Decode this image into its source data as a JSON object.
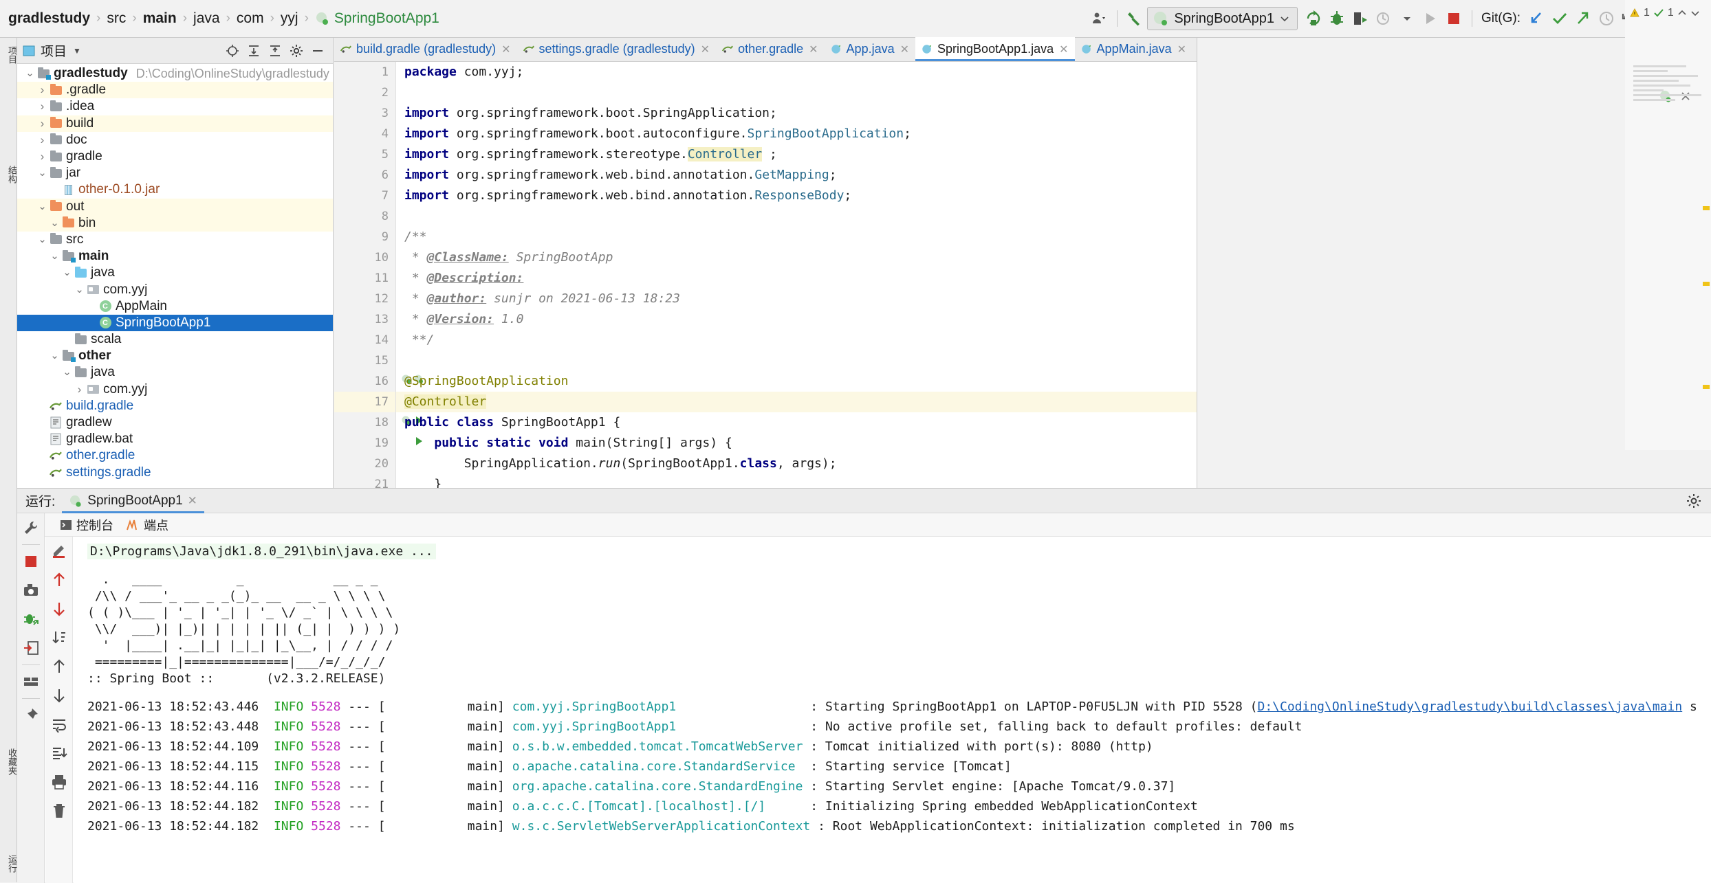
{
  "breadcrumb": {
    "items": [
      {
        "label": "gradlestudy",
        "bold": true
      },
      {
        "label": "src",
        "bold": false
      },
      {
        "label": "main",
        "bold": true
      },
      {
        "label": "java",
        "bold": false
      },
      {
        "label": "com",
        "bold": false
      },
      {
        "label": "yyj",
        "bold": false
      },
      {
        "label": "SpringBootApp1",
        "bold": false
      }
    ]
  },
  "toolbar": {
    "run_config_label": "SpringBootApp1",
    "git_label": "Git(G):",
    "icons": [
      "profile-icon",
      "build-hammer-icon",
      "rerun-icon",
      "debug-icon",
      "run-with-coverage-icon",
      "profile-run-icon",
      "run-icon",
      "stop-icon",
      "git-update-icon",
      "git-commit-icon",
      "git-push-icon",
      "git-history-icon",
      "git-rollback-icon",
      "translate-icon",
      "search-everywhere-icon"
    ]
  },
  "left_strip": {
    "project_tab": "项目",
    "structure_tab": "结构",
    "favorites_tab": "收藏夹",
    "run_tab": "运行"
  },
  "project_panel": {
    "title": "项目",
    "header_icons": [
      "locate-icon",
      "expand-all-icon",
      "collapse-all-icon",
      "settings-gear-icon",
      "hide-icon"
    ],
    "tree": [
      {
        "depth": 0,
        "arrow": "down",
        "icon": "module-folder",
        "label": "gradlestudy",
        "bold": true,
        "path": "D:\\Coding\\OnlineStudy\\gradlestudy",
        "hl": false,
        "sel": false
      },
      {
        "depth": 1,
        "arrow": "right",
        "icon": "folder-orange",
        "label": ".gradle",
        "bold": false,
        "path": "",
        "hl": true,
        "sel": false
      },
      {
        "depth": 1,
        "arrow": "right",
        "icon": "folder-grey",
        "label": ".idea",
        "bold": false,
        "path": "",
        "hl": false,
        "sel": false
      },
      {
        "depth": 1,
        "arrow": "right",
        "icon": "folder-orange",
        "label": "build",
        "bold": false,
        "path": "",
        "hl": true,
        "sel": false
      },
      {
        "depth": 1,
        "arrow": "right",
        "icon": "folder-grey",
        "label": "doc",
        "bold": false,
        "path": "",
        "hl": false,
        "sel": false
      },
      {
        "depth": 1,
        "arrow": "right",
        "icon": "folder-grey",
        "label": "gradle",
        "bold": false,
        "path": "",
        "hl": false,
        "sel": false
      },
      {
        "depth": 1,
        "arrow": "down",
        "icon": "folder-grey",
        "label": "jar",
        "bold": false,
        "path": "",
        "hl": false,
        "sel": false
      },
      {
        "depth": 2,
        "arrow": "none",
        "icon": "jar-file",
        "label": "other-0.1.0.jar",
        "bold": false,
        "path": "",
        "hl": false,
        "sel": false,
        "color": "#9c4a22"
      },
      {
        "depth": 1,
        "arrow": "down",
        "icon": "folder-orange",
        "label": "out",
        "bold": false,
        "path": "",
        "hl": true,
        "sel": false
      },
      {
        "depth": 2,
        "arrow": "down",
        "icon": "folder-orange",
        "label": "bin",
        "bold": false,
        "path": "",
        "hl": true,
        "sel": false
      },
      {
        "depth": 1,
        "arrow": "down",
        "icon": "folder-grey",
        "label": "src",
        "bold": false,
        "path": "",
        "hl": false,
        "sel": false
      },
      {
        "depth": 2,
        "arrow": "down",
        "icon": "module-folder",
        "label": "main",
        "bold": true,
        "path": "",
        "hl": false,
        "sel": false
      },
      {
        "depth": 3,
        "arrow": "down",
        "icon": "folder-blue",
        "label": "java",
        "bold": false,
        "path": "",
        "hl": false,
        "sel": false
      },
      {
        "depth": 4,
        "arrow": "down",
        "icon": "package",
        "label": "com.yyj",
        "bold": false,
        "path": "",
        "hl": false,
        "sel": false
      },
      {
        "depth": 5,
        "arrow": "none",
        "icon": "java-class",
        "label": "AppMain",
        "bold": false,
        "path": "",
        "hl": false,
        "sel": false
      },
      {
        "depth": 5,
        "arrow": "none",
        "icon": "java-class",
        "label": "SpringBootApp1",
        "bold": false,
        "path": "",
        "hl": false,
        "sel": true
      },
      {
        "depth": 3,
        "arrow": "none",
        "icon": "folder-grey",
        "label": "scala",
        "bold": false,
        "path": "",
        "hl": false,
        "sel": false
      },
      {
        "depth": 2,
        "arrow": "down",
        "icon": "module-folder",
        "label": "other",
        "bold": true,
        "path": "",
        "hl": false,
        "sel": false
      },
      {
        "depth": 3,
        "arrow": "down",
        "icon": "folder-grey",
        "label": "java",
        "bold": false,
        "path": "",
        "hl": false,
        "sel": false
      },
      {
        "depth": 4,
        "arrow": "right",
        "icon": "package",
        "label": "com.yyj",
        "bold": false,
        "path": "",
        "hl": false,
        "sel": false
      },
      {
        "depth": 1,
        "arrow": "none",
        "icon": "gradle-file",
        "label": "build.gradle",
        "bold": false,
        "path": "",
        "hl": false,
        "sel": false,
        "color": "#1a5fb4"
      },
      {
        "depth": 1,
        "arrow": "none",
        "icon": "script-file",
        "label": "gradlew",
        "bold": false,
        "path": "",
        "hl": false,
        "sel": false
      },
      {
        "depth": 1,
        "arrow": "none",
        "icon": "script-file",
        "label": "gradlew.bat",
        "bold": false,
        "path": "",
        "hl": false,
        "sel": false
      },
      {
        "depth": 1,
        "arrow": "none",
        "icon": "gradle-file",
        "label": "other.gradle",
        "bold": false,
        "path": "",
        "hl": false,
        "sel": false,
        "color": "#1a5fb4"
      },
      {
        "depth": 1,
        "arrow": "none",
        "icon": "gradle-file",
        "label": "settings.gradle",
        "bold": false,
        "path": "",
        "hl": false,
        "sel": false,
        "color": "#1a5fb4"
      }
    ]
  },
  "editor": {
    "tabs": [
      {
        "label": "build.gradle (gradlestudy)",
        "icon": "gradle-icon",
        "active": false
      },
      {
        "label": "settings.gradle (gradlestudy)",
        "icon": "gradle-icon",
        "active": false
      },
      {
        "label": "other.gradle",
        "icon": "gradle-icon",
        "active": false
      },
      {
        "label": "App.java",
        "icon": "java-icon",
        "active": false
      },
      {
        "label": "SpringBootApp1.java",
        "icon": "java-icon",
        "active": true
      },
      {
        "label": "AppMain.java",
        "icon": "java-icon",
        "active": false
      }
    ],
    "inspection": {
      "warnings": "1",
      "checks": "1"
    },
    "gutter_numbers": [
      "1",
      "2",
      "3",
      "4",
      "5",
      "6",
      "7",
      "8",
      "9",
      "10",
      "11",
      "12",
      "13",
      "14",
      "15",
      "16",
      "17",
      "18",
      "19",
      "20",
      "21"
    ],
    "current_line": 17,
    "code": [
      {
        "n": 1,
        "html": "<span class=\"kw\">package</span> com.yyj;"
      },
      {
        "n": 2,
        "html": ""
      },
      {
        "n": 3,
        "html": "<span class=\"kw\">import</span> org.springframework.boot.SpringApplication;"
      },
      {
        "n": 4,
        "html": "<span class=\"kw\">import</span> org.springframework.boot.autoconfigure.<span class=\"cls\">SpringBootApplication</span>;"
      },
      {
        "n": 5,
        "html": "<span class=\"kw\">import</span> org.springframework.stereotype.<span class=\"hiwarn cls\">Controller</span> ;"
      },
      {
        "n": 6,
        "html": "<span class=\"kw\">import</span> org.springframework.web.bind.annotation.<span class=\"cls\">GetMapping</span>;"
      },
      {
        "n": 7,
        "html": "<span class=\"kw\">import</span> org.springframework.web.bind.annotation.<span class=\"cls\">ResponseBody</span>;"
      },
      {
        "n": 8,
        "html": ""
      },
      {
        "n": 9,
        "html": "<span class=\"cmt\">/**</span>"
      },
      {
        "n": 10,
        "html": "<span class=\"cmt\"> * </span><span class=\"cmt-b\">@ClassName:</span><span class=\"cmt\"> SpringBootApp</span>"
      },
      {
        "n": 11,
        "html": "<span class=\"cmt\"> * </span><span class=\"cmt-b\">@Description:</span>"
      },
      {
        "n": 12,
        "html": "<span class=\"cmt\"> * </span><span class=\"cmt-b\">@author:</span><span class=\"cmt\"> sunjr on 2021-06-13 18:23</span>"
      },
      {
        "n": 13,
        "html": "<span class=\"cmt\"> * </span><span class=\"cmt-b\">@Version:</span><span class=\"cmt\"> 1.0</span>"
      },
      {
        "n": 14,
        "html": "<span class=\"cmt\"> **/</span>"
      },
      {
        "n": 15,
        "html": ""
      },
      {
        "n": 16,
        "html": "<span class=\"ann\">@SpringBootApplication</span>"
      },
      {
        "n": 17,
        "html": "<span class=\"ann hiwarn\">@Controller</span>"
      },
      {
        "n": 18,
        "html": "<span class=\"kw\">public class</span> SpringBootApp1 {"
      },
      {
        "n": 19,
        "html": "    <span class=\"kw\">public static void</span> main(String[] args) {"
      },
      {
        "n": 20,
        "html": "        SpringApplication.<span style=\"font-style:italic\">run</span>(SpringBootApp1.<span class=\"kw\">class</span>, args);"
      },
      {
        "n": 21,
        "html": "    }"
      }
    ]
  },
  "run_panel": {
    "title": "运行:",
    "tab_label": "SpringBootApp1",
    "subtabs": [
      {
        "label": "控制台",
        "icon": "console-icon"
      },
      {
        "label": "端点",
        "icon": "endpoints-icon"
      }
    ],
    "left_icons_1": [
      "wrench-icon",
      "stop-icon",
      "camera-icon",
      "debug-attach-icon",
      "export-icon",
      "layout-icon",
      "pin-icon"
    ],
    "left_icons_2": [
      "highlight-icon",
      "up-red-icon",
      "down-red-icon",
      "sort-down-icon",
      "up-icon",
      "down-icon",
      "soft-wrap-icon",
      "scroll-to-end-icon",
      "print-icon",
      "trash-icon"
    ],
    "command": "D:\\Programs\\Java\\jdk1.8.0_291\\bin\\java.exe ...",
    "banner": [
      "  .   ____          _            __ _ _",
      " /\\\\ / ___'_ __ _ _(_)_ __  __ _ \\ \\ \\ \\",
      "( ( )\\___ | '_ | '_| | '_ \\/ _` | \\ \\ \\ \\",
      " \\\\/  ___)| |_)| | | | | || (_| |  ) ) ) )",
      "  '  |____| .__|_| |_|_| |_\\__, | / / / /",
      " =========|_|==============|___/=/_/_/_/"
    ],
    "banner_version_label": ":: Spring Boot ::",
    "banner_version": "(v2.3.2.RELEASE)",
    "logs": [
      {
        "ts": "2021-06-13 18:52:43.446",
        "level": "INFO",
        "pid": "5528",
        "sep": "--- [",
        "thread": "           main]",
        "logger": "com.yyj.SpringBootApp1",
        "msg": ": Starting SpringBootApp1 on LAPTOP-P0FU5LJN with PID 5528 (",
        "link": "D:\\Coding\\OnlineStudy\\gradlestudy\\build\\classes\\java\\main",
        "tail": " s"
      },
      {
        "ts": "2021-06-13 18:52:43.448",
        "level": "INFO",
        "pid": "5528",
        "sep": "--- [",
        "thread": "           main]",
        "logger": "com.yyj.SpringBootApp1",
        "msg": ": No active profile set, falling back to default profiles: default",
        "link": "",
        "tail": ""
      },
      {
        "ts": "2021-06-13 18:52:44.109",
        "level": "INFO",
        "pid": "5528",
        "sep": "--- [",
        "thread": "           main]",
        "logger": "o.s.b.w.embedded.tomcat.TomcatWebServer",
        "msg": ": Tomcat initialized with port(s): 8080 (http)",
        "link": "",
        "tail": ""
      },
      {
        "ts": "2021-06-13 18:52:44.115",
        "level": "INFO",
        "pid": "5528",
        "sep": "--- [",
        "thread": "           main]",
        "logger": "o.apache.catalina.core.StandardService",
        "msg": ": Starting service [Tomcat]",
        "link": "",
        "tail": ""
      },
      {
        "ts": "2021-06-13 18:52:44.116",
        "level": "INFO",
        "pid": "5528",
        "sep": "--- [",
        "thread": "           main]",
        "logger": "org.apache.catalina.core.StandardEngine",
        "msg": ": Starting Servlet engine: [Apache Tomcat/9.0.37]",
        "link": "",
        "tail": ""
      },
      {
        "ts": "2021-06-13 18:52:44.182",
        "level": "INFO",
        "pid": "5528",
        "sep": "--- [",
        "thread": "           main]",
        "logger": "o.a.c.c.C.[Tomcat].[localhost].[/]",
        "msg": ": Initializing Spring embedded WebApplicationContext",
        "link": "",
        "tail": ""
      },
      {
        "ts": "2021-06-13 18:52:44.182",
        "level": "INFO",
        "pid": "5528",
        "sep": "--- [",
        "thread": "           main]",
        "logger": "w.s.c.ServletWebServerApplicationContext",
        "msg": ": Root WebApplicationContext: initialization completed in 700 ms",
        "link": "",
        "tail": ""
      }
    ]
  },
  "colors": {
    "accent_blue": "#4a90d9",
    "selection_blue": "#1a6ec6",
    "highlight_yellow": "#fffbe6",
    "green": "#2d8a3e",
    "red": "#d0342c"
  }
}
